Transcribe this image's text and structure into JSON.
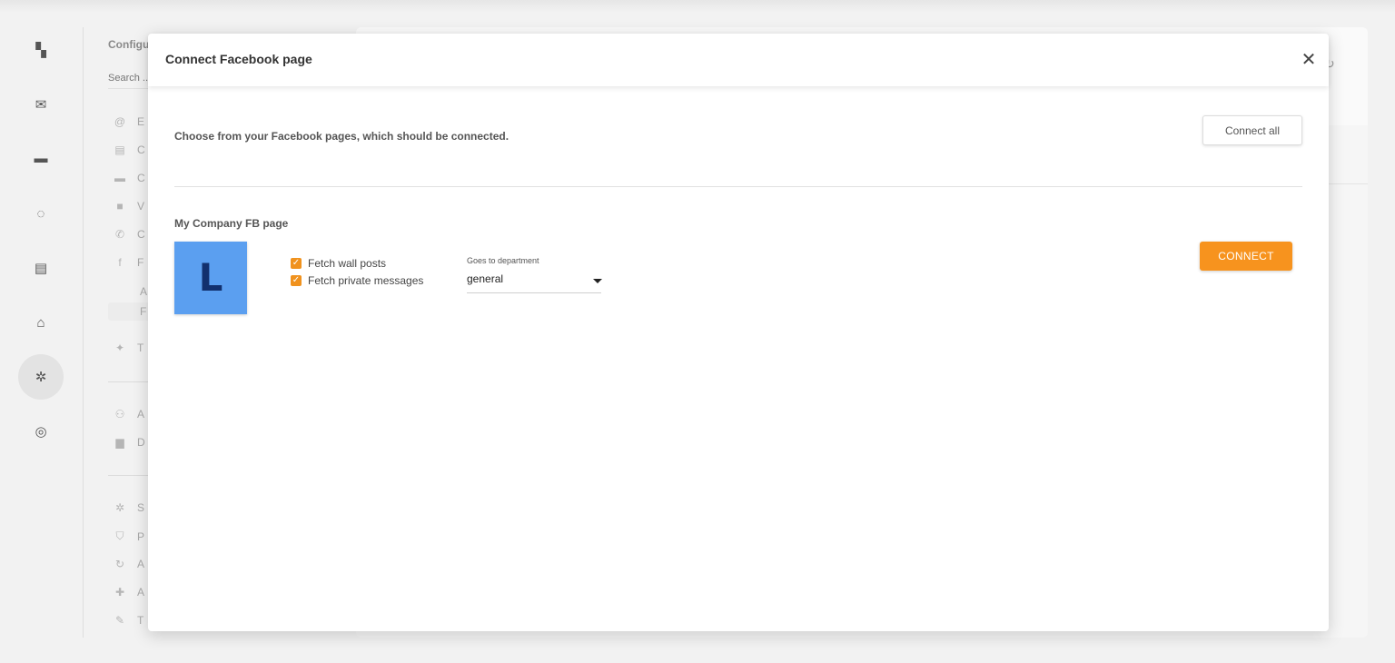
{
  "rail": {
    "items": [
      {
        "name": "dashboard-icon",
        "glyph": "▚"
      },
      {
        "name": "mail-icon",
        "glyph": "✉"
      },
      {
        "name": "chat-icon",
        "glyph": "▬"
      },
      {
        "name": "reports-icon",
        "glyph": "◌"
      },
      {
        "name": "contacts-icon",
        "glyph": "▤"
      },
      {
        "name": "knowledgebase-icon",
        "glyph": "⌂"
      },
      {
        "name": "settings-icon",
        "glyph": "✲"
      },
      {
        "name": "tasks-icon",
        "glyph": "◎"
      }
    ]
  },
  "config": {
    "title": "Configu",
    "search_placeholder": "Search ...",
    "items": [
      {
        "icon": "@",
        "label": "E"
      },
      {
        "icon": "▤",
        "label": "C"
      },
      {
        "icon": "▬",
        "label": "C"
      },
      {
        "icon": "■",
        "label": "V"
      },
      {
        "icon": "✆",
        "label": "C"
      },
      {
        "icon": "f",
        "label": "F"
      },
      {
        "icon": "✦",
        "label": "T"
      },
      {
        "icon": "⚇",
        "label": "A"
      },
      {
        "icon": "▆",
        "label": "D"
      },
      {
        "icon": "✲",
        "label": "S"
      },
      {
        "icon": "⛉",
        "label": "P"
      },
      {
        "icon": "↻",
        "label": "A"
      },
      {
        "icon": "✚",
        "label": "A"
      },
      {
        "icon": "✎",
        "label": "T"
      }
    ],
    "sub_items": [
      "A",
      "F"
    ]
  },
  "modal": {
    "title": "Connect Facebook page",
    "close_glyph": "✕",
    "intro": "Choose from your Facebook pages, which should be connected.",
    "connect_all_label": "Connect all",
    "page": {
      "name": "My Company FB page",
      "logo_letter": "L",
      "logo_color": "#5b9ff0",
      "fetch_wall_posts_label": "Fetch wall posts",
      "fetch_private_messages_label": "Fetch private messages",
      "department_label": "Goes to department",
      "department_value": "general",
      "connect_label": "CONNECT"
    }
  },
  "colors": {
    "accent": "#f7931e",
    "background": "#f2f2f2"
  }
}
